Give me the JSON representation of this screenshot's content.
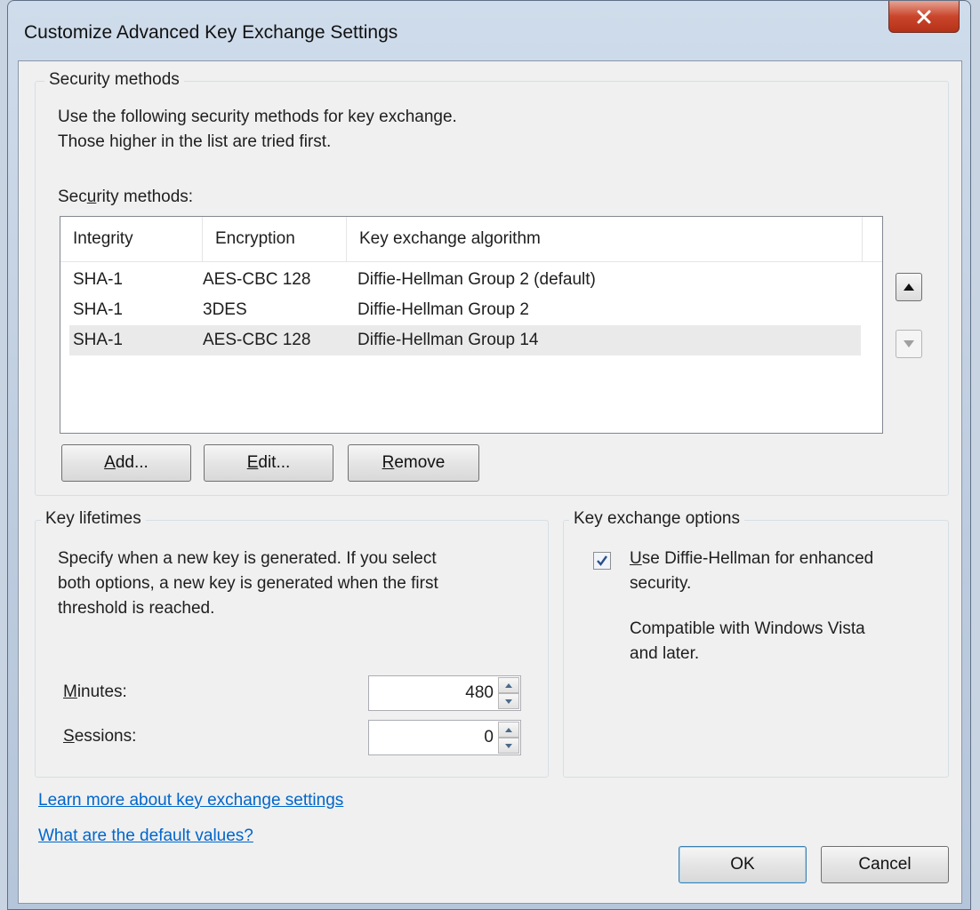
{
  "window": {
    "title": "Customize Advanced Key Exchange Settings",
    "close_label": "X"
  },
  "security": {
    "group_title": "Security methods",
    "description_line1": "Use the following security methods for key exchange.",
    "description_line2": "Those higher in the list are tried first.",
    "list_label": "Security methods:",
    "columns": [
      "Integrity",
      "Encryption",
      "Key exchange algorithm"
    ],
    "rows": [
      {
        "integrity": "SHA-1",
        "encryption": "AES-CBC 128",
        "algorithm": "Diffie-Hellman Group 2 (default)"
      },
      {
        "integrity": "SHA-1",
        "encryption": "3DES",
        "algorithm": "Diffie-Hellman Group 2"
      },
      {
        "integrity": "SHA-1",
        "encryption": "AES-CBC 128",
        "algorithm": "Diffie-Hellman Group 14"
      }
    ],
    "selected_row_index": 2,
    "add_label": "Add...",
    "edit_label": "Edit...",
    "remove_label": "Remove",
    "move_up_icon": "triangle-up-icon",
    "move_down_icon": "triangle-down-icon"
  },
  "lifetimes": {
    "group_title": "Key lifetimes",
    "description_line1": "Specify when a new key is generated. If you select",
    "description_line2": "both options, a new key is generated when the first",
    "description_line3": "threshold is reached.",
    "minutes_label": "Minutes:",
    "minutes_value": "480",
    "sessions_label": "Sessions:",
    "sessions_value": "0"
  },
  "options": {
    "group_title": "Key exchange options",
    "checkbox_line1": "Use Diffie-Hellman for enhanced",
    "checkbox_line2": "security.",
    "checkbox_checked": true,
    "note_line1": "Compatible with Windows Vista",
    "note_line2": "and later."
  },
  "links": {
    "learn_more": "Learn more about key exchange settings",
    "defaults": "What are the default values?"
  },
  "footer": {
    "ok_label": "OK",
    "cancel_label": "Cancel"
  },
  "colors": {
    "link": "#0066cc",
    "close_button": "#c9452b",
    "dialog_background": "#f0f0f0"
  }
}
